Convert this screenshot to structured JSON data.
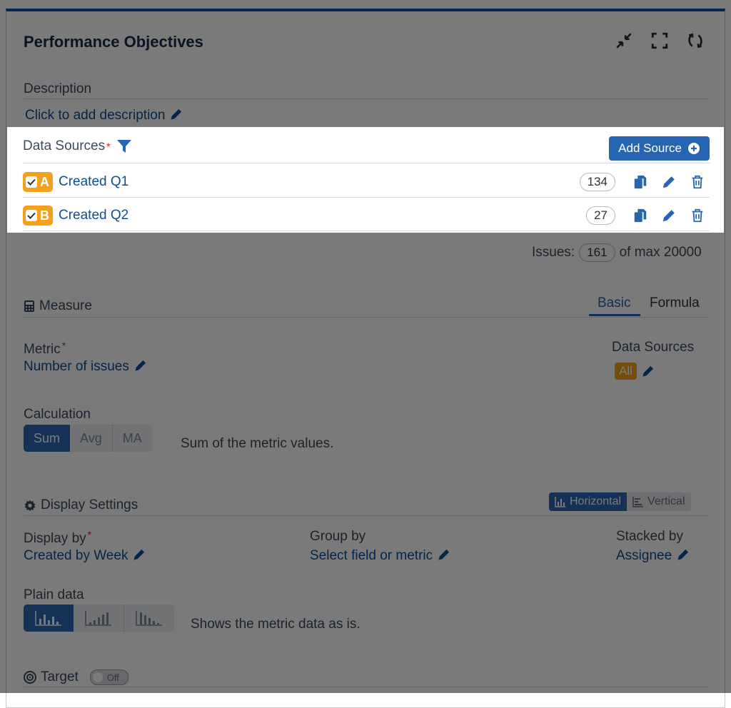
{
  "panel": {
    "title": "Performance Objectives"
  },
  "description": {
    "label": "Description",
    "add_link": "Click to add description"
  },
  "data_sources": {
    "label": "Data Sources",
    "required": "*",
    "add_button": "Add Source",
    "items": [
      {
        "letter": "A",
        "name": "Created Q1",
        "count": "134"
      },
      {
        "letter": "B",
        "name": "Created Q2",
        "count": "27"
      }
    ],
    "issues_label": "Issues:",
    "issues_count": "161",
    "issues_max": "of max 20000"
  },
  "measure": {
    "label": "Measure",
    "tabs": [
      "Basic",
      "Formula"
    ],
    "metric_label": "Metric",
    "metric_value": "Number of issues",
    "data_sources_label": "Data Sources",
    "data_sources_value": "All",
    "calculation_label": "Calculation",
    "calc_options": [
      "Sum",
      "Avg",
      "MA"
    ],
    "calc_desc": "Sum of the metric values."
  },
  "display": {
    "label": "Display Settings",
    "orient_horizontal": "Horizontal",
    "orient_vertical": "Vertical",
    "display_by_label": "Display by",
    "display_by_value": "Created by Week",
    "group_by_label": "Group by",
    "group_by_value": "Select field or metric",
    "stacked_by_label": "Stacked by",
    "stacked_by_value": "Assignee",
    "plain_data_label": "Plain data",
    "plain_data_desc": "Shows the metric data as is."
  },
  "target": {
    "label": "Target",
    "toggle": "Off"
  },
  "colors": {
    "accent": "#2565b2",
    "badge": "#f3a11c",
    "topbar": "#0b4fa3"
  }
}
